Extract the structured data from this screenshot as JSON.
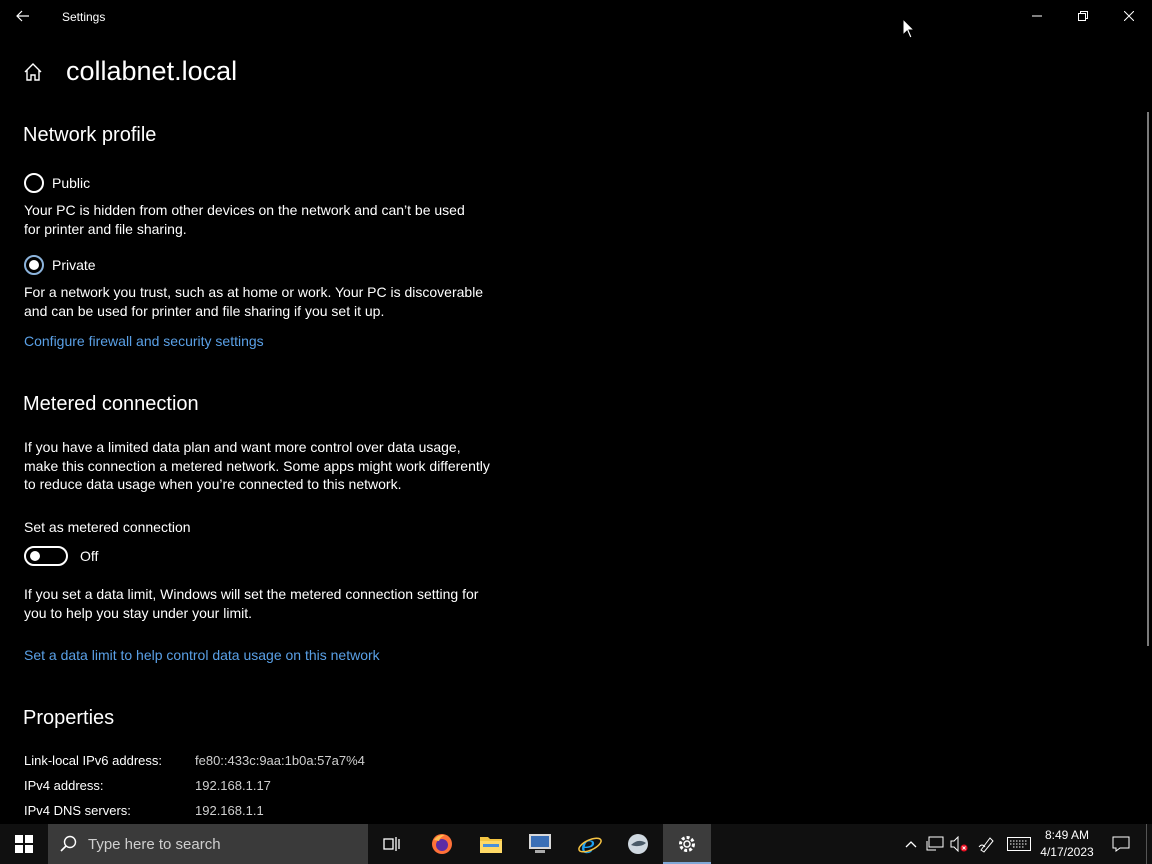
{
  "window": {
    "title": "Settings",
    "page_title": "collabnet.local"
  },
  "network_profile": {
    "heading": "Network profile",
    "public_label": "Public",
    "public_desc": "Your PC is hidden from other devices on the network and can’t be used for printer and file sharing.",
    "private_label": "Private",
    "private_desc": "For a network you trust, such as at home or work. Your PC is discoverable and can be used for printer and file sharing if you set it up.",
    "selected": "Private",
    "firewall_link": "Configure firewall and security settings"
  },
  "metered": {
    "heading": "Metered connection",
    "desc": "If you have a limited data plan and want more control over data usage, make this connection a metered network. Some apps might work differently to reduce data usage when you’re connected to this network.",
    "toggle_label": "Set as metered connection",
    "toggle_state": "Off",
    "limit_desc": "If you set a data limit, Windows will set the metered connection setting for you to help you stay under your limit.",
    "limit_link": "Set a data limit to help control data usage on this network"
  },
  "properties": {
    "heading": "Properties",
    "rows": [
      {
        "label": "Link-local IPv6 address:",
        "value": "fe80::433c:9aa:1b0a:57a7%4"
      },
      {
        "label": "IPv4 address:",
        "value": "192.168.1.17"
      },
      {
        "label": "IPv4 DNS servers:",
        "value": "192.168.1.1"
      }
    ]
  },
  "taskbar": {
    "search_placeholder": "Type here to search",
    "apps": [
      "task-view",
      "firefox",
      "file-explorer",
      "network-manager",
      "internet-explorer",
      "app",
      "settings"
    ],
    "time": "8:49 AM",
    "date": "4/17/2023"
  },
  "colors": {
    "accent_link": "#5aa0e6",
    "taskbar": "#101010",
    "search_box": "#3a3a3a"
  }
}
